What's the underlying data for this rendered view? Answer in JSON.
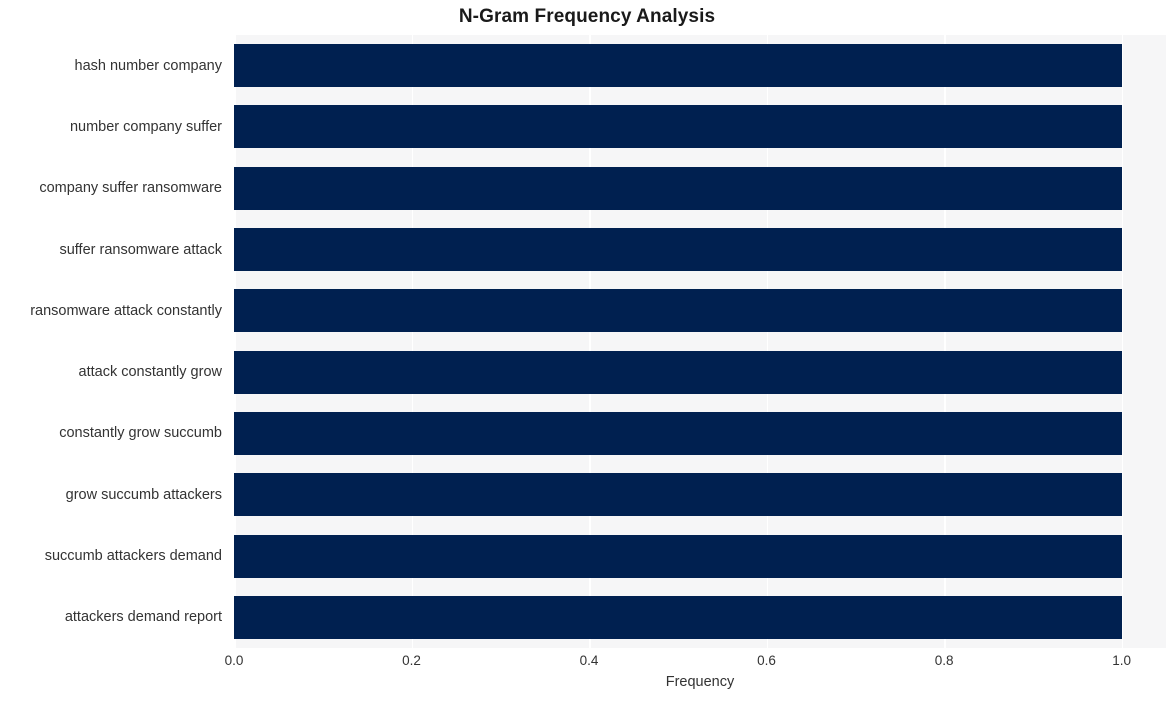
{
  "chart_data": {
    "type": "bar",
    "orientation": "horizontal",
    "title": "N-Gram Frequency Analysis",
    "xlabel": "Frequency",
    "ylabel": "",
    "categories": [
      "hash number company",
      "number company suffer",
      "company suffer ransomware",
      "suffer ransomware attack",
      "ransomware attack constantly",
      "attack constantly grow",
      "constantly grow succumb",
      "grow succumb attackers",
      "succumb attackers demand",
      "attackers demand report"
    ],
    "values": [
      1.0,
      1.0,
      1.0,
      1.0,
      1.0,
      1.0,
      1.0,
      1.0,
      1.0,
      1.0
    ],
    "xlim": [
      0.0,
      1.05
    ],
    "xticks": [
      0.0,
      0.2,
      0.4,
      0.6,
      0.8,
      1.0
    ],
    "xtick_labels": [
      "0.0",
      "0.2",
      "0.4",
      "0.6",
      "0.8",
      "1.0"
    ],
    "grid": true,
    "grid_axis": "x",
    "legend": false,
    "bar_color": "#002050",
    "plot_background": "#f6f6f7",
    "figure_background": "#ffffff",
    "grid_color": "#ffffff",
    "text_color": "#333333",
    "title_color": "#1a1a1a"
  }
}
